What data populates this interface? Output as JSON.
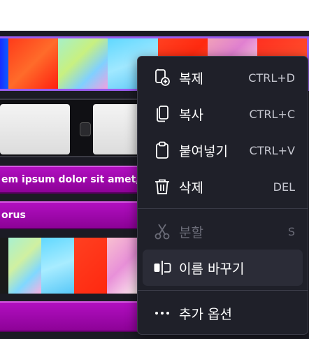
{
  "colors": {
    "menu_bg": "#1f2029",
    "menu_hover": "#2b2c37",
    "timeline_bg": "#1b1b24",
    "selection_outline": "#9a5df0",
    "text_clip": "#9b06a6",
    "disabled_text": "#6b6c78"
  },
  "timeline": {
    "text_clip_1": "em ipsum dolor sit amet,",
    "text_clip_2": "orus",
    "text_clip_3": ""
  },
  "context_menu": {
    "items": [
      {
        "icon": "duplicate-icon",
        "label": "복제",
        "shortcut": "CTRL+D",
        "disabled": false
      },
      {
        "icon": "copy-icon",
        "label": "복사",
        "shortcut": "CTRL+C",
        "disabled": false
      },
      {
        "icon": "paste-icon",
        "label": "붙여넣기",
        "shortcut": "CTRL+V",
        "disabled": false
      },
      {
        "icon": "trash-icon",
        "label": "삭제",
        "shortcut": "DEL",
        "disabled": false
      },
      {
        "icon": "scissors-icon",
        "label": "분할",
        "shortcut": "S",
        "disabled": true
      },
      {
        "icon": "rename-icon",
        "label": "이름 바꾸기",
        "shortcut": "",
        "disabled": false
      },
      {
        "icon": "more-options-icon",
        "label": "추가 옵션",
        "shortcut": "",
        "disabled": false
      }
    ]
  }
}
